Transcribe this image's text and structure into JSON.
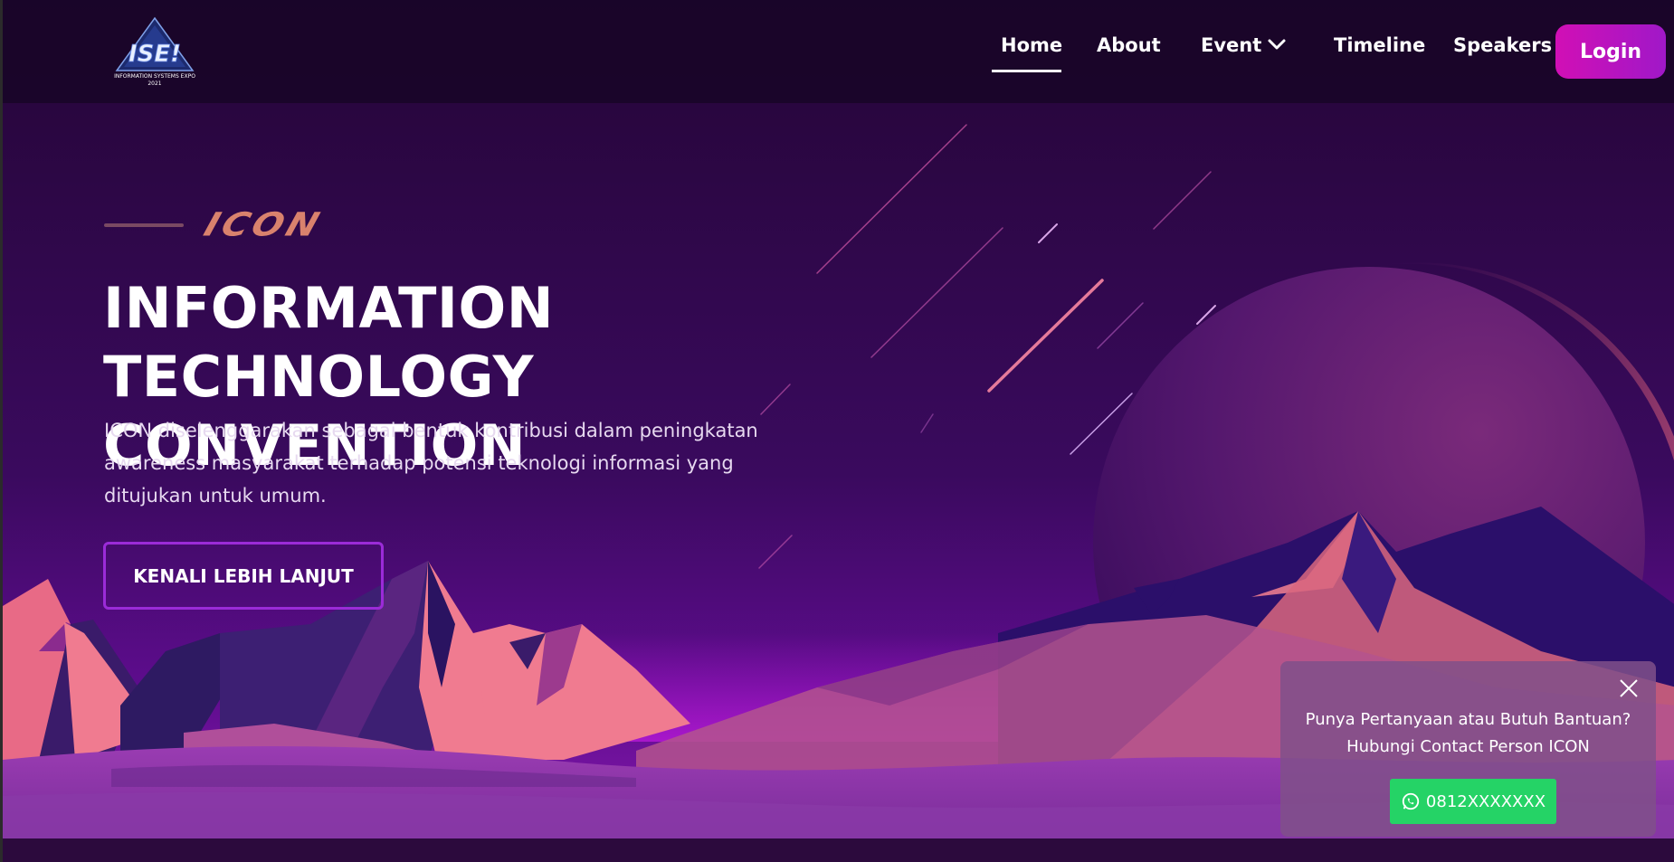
{
  "navbar": {
    "logo": {
      "text": "ISE!",
      "subtitle": "INFORMATION SYSTEMS EXPO",
      "year": "2021"
    },
    "links": {
      "home": "Home",
      "about": "About",
      "event": "Event",
      "timeline": "Timeline",
      "speakers": "Speakers"
    },
    "active": "Home",
    "login_label": "Login"
  },
  "hero": {
    "brand": "ICON",
    "title_line1": "INFORMATION",
    "title_line2": "TECHNOLOGY CONVENTION",
    "description": "ICON diselenggarakan sebagai bentuk kontribusi dalam peningkatan awareness masyarakat terhadap potensi teknologi informasi yang ditujukan untuk umum.",
    "cta_label": "KENALI LEBIH LANJUT"
  },
  "help_popup": {
    "line1": "Punya Pertanyaan atau Butuh Bantuan?",
    "line2": "Hubungi Contact Person ICON",
    "whatsapp_number": "0812XXXXXXX"
  },
  "colors": {
    "background": "#1f0533",
    "accent": "#c214b8",
    "cta_border": "#9b2bd8",
    "whatsapp": "#25d366",
    "mountain_pink": "#f0788c"
  }
}
